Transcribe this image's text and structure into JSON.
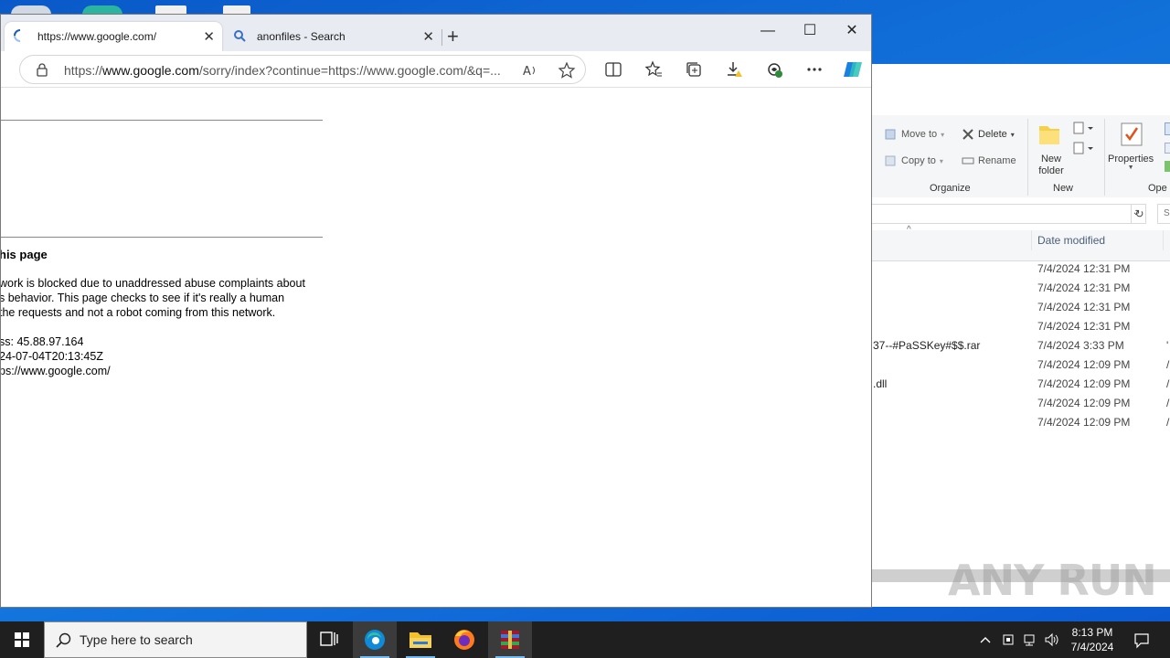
{
  "browser": {
    "tabs": [
      {
        "title": "https://www.google.com/",
        "active": true,
        "icon": "loading-spinner-icon"
      },
      {
        "title": "anonfiles - Search",
        "active": false,
        "icon": "search-icon"
      }
    ],
    "url": {
      "prefix": "https://",
      "domain": "www.google.com",
      "rest": "/sorry/index?continue=https://www.google.com/&q=..."
    }
  },
  "page": {
    "heading": "his page",
    "paragraph": [
      "work is blocked due to unaddressed abuse complaints about",
      "s behavior. This page checks to see if it's really a human",
      "the requests and not a robot coming from this network."
    ],
    "details": [
      "ss: 45.88.97.164",
      "24-07-04T20:13:45Z",
      "ps://www.google.com/"
    ]
  },
  "explorer": {
    "ribbon": {
      "move_to": "Move to",
      "copy_to": "Copy to",
      "delete": "Delete",
      "rename": "Rename",
      "new_folder_line1": "New",
      "new_folder_line2": "folder",
      "properties": "Properties",
      "group_organize": "Organize",
      "group_new": "New",
      "group_open": "Ope"
    },
    "column_date": "Date modified",
    "files": [
      {
        "name": "",
        "date": "7/4/2024 12:31 PM",
        "mark": ""
      },
      {
        "name": "",
        "date": "7/4/2024 12:31 PM",
        "mark": ""
      },
      {
        "name": "",
        "date": "7/4/2024 12:31 PM",
        "mark": ""
      },
      {
        "name": "",
        "date": "7/4/2024 12:31 PM",
        "mark": ""
      },
      {
        "name": "37--#PaSSKey#$$.rar",
        "date": "7/4/2024 3:33 PM",
        "mark": "'"
      },
      {
        "name": "",
        "date": "7/4/2024 12:09 PM",
        "mark": "/"
      },
      {
        "name": ".dll",
        "date": "7/4/2024 12:09 PM",
        "mark": "/"
      },
      {
        "name": "",
        "date": "7/4/2024 12:09 PM",
        "mark": "/"
      },
      {
        "name": "",
        "date": "7/4/2024 12:09 PM",
        "mark": "/"
      }
    ]
  },
  "watermark": "ANY RUN",
  "taskbar": {
    "search_placeholder": "Type here to search",
    "time": "8:13 PM",
    "date": "7/4/2024"
  },
  "colors": {
    "accent": "#0078d4",
    "taskbar": "#1f1f1f",
    "desktop": "#1477de"
  }
}
